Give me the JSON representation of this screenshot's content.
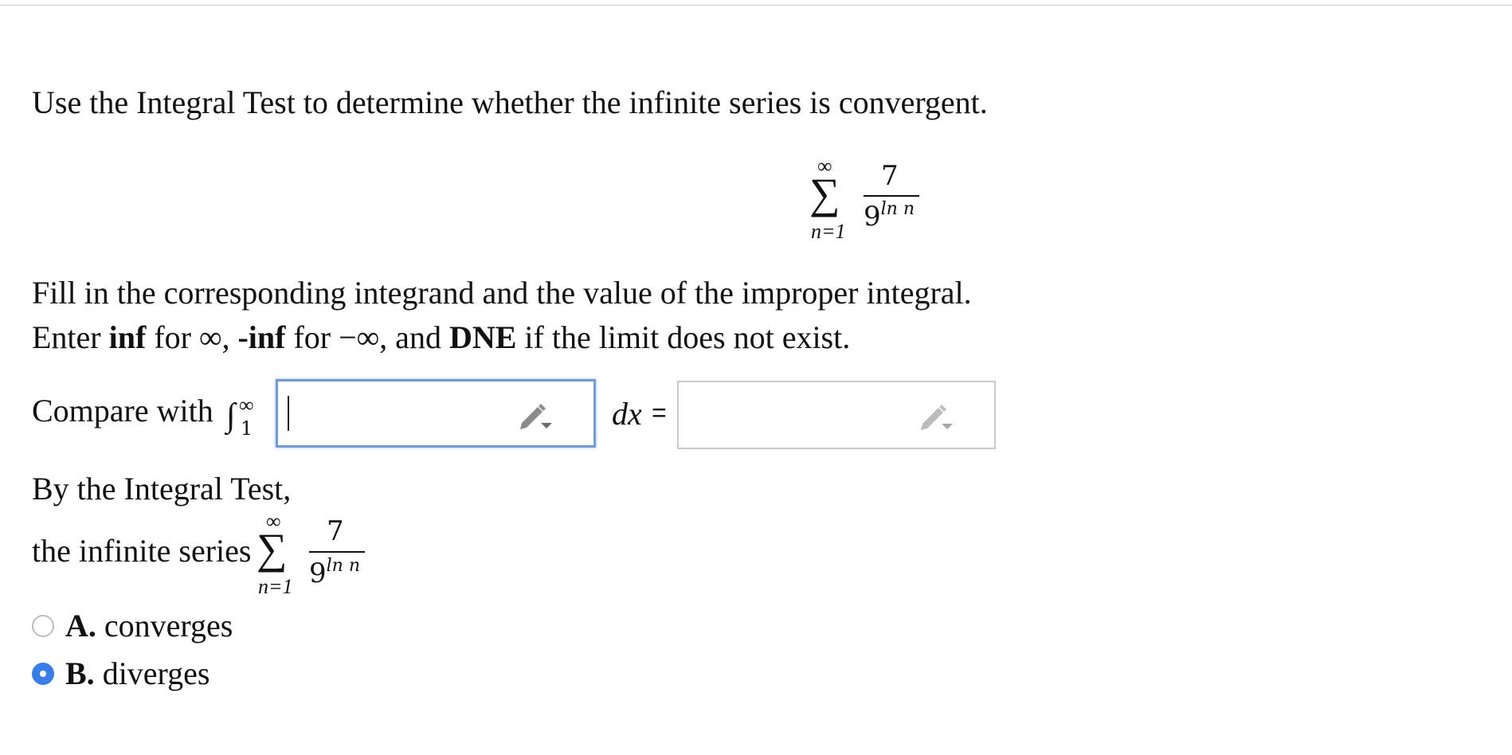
{
  "prompt": {
    "instruction": "Use the Integral Test to determine whether the infinite series is convergent.",
    "fill_line": "Fill in the corresponding integrand and the value of the improper integral.",
    "enter_line": {
      "t1": "Enter ",
      "inf": "inf",
      "t2": " for ∞, ",
      "neginf": "-inf",
      "t3": " for −∞, and ",
      "dne": "DNE",
      "t4": " if the limit does not exist."
    }
  },
  "series": {
    "upper": "∞",
    "sigma": "∑",
    "lower": "n=1",
    "numerator": "7",
    "denominator_base": "9",
    "denominator_exp": "ln n"
  },
  "compare": {
    "label": "Compare with ",
    "integral_sign": "∫",
    "upper": "∞",
    "lower": "1",
    "integrand_value": "",
    "dx": "dx",
    "equals": "=",
    "value": ""
  },
  "conclusion": {
    "line1": "By the Integral Test,",
    "line2": "the infinite series"
  },
  "options": [
    {
      "letter": "A.",
      "text": "converges",
      "selected": false
    },
    {
      "letter": "B.",
      "text": "diverges",
      "selected": true
    }
  ],
  "icons": {
    "pencil_icon": "pencil-with-dropdown"
  },
  "colors": {
    "focus_border": "#6f9bd6",
    "radio_selected": "#3b7de8",
    "input_border": "#c9c9c9"
  }
}
